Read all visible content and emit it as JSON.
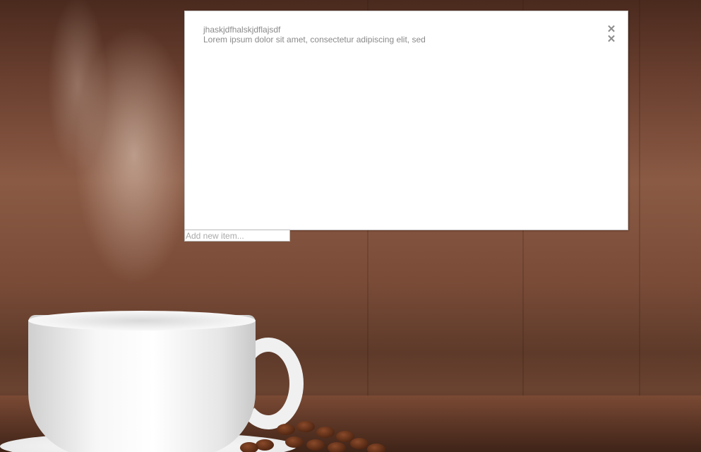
{
  "todo": {
    "items": [
      {
        "text": "jhaskjdfhalskjdflajsdf",
        "remove_icon": "close-icon",
        "remove_glyph": "✕"
      },
      {
        "text": "Lorem ipsum dolor sit amet, consectetur adipiscing elit, sed",
        "remove_icon": "close-icon",
        "remove_glyph": "✕"
      }
    ],
    "new_item_placeholder": "Add new item...",
    "new_item_value": ""
  },
  "colors": {
    "panel_background": "#ffffff",
    "item_text": "#8a8a8a",
    "remove_icon": "#8e8e8e"
  }
}
